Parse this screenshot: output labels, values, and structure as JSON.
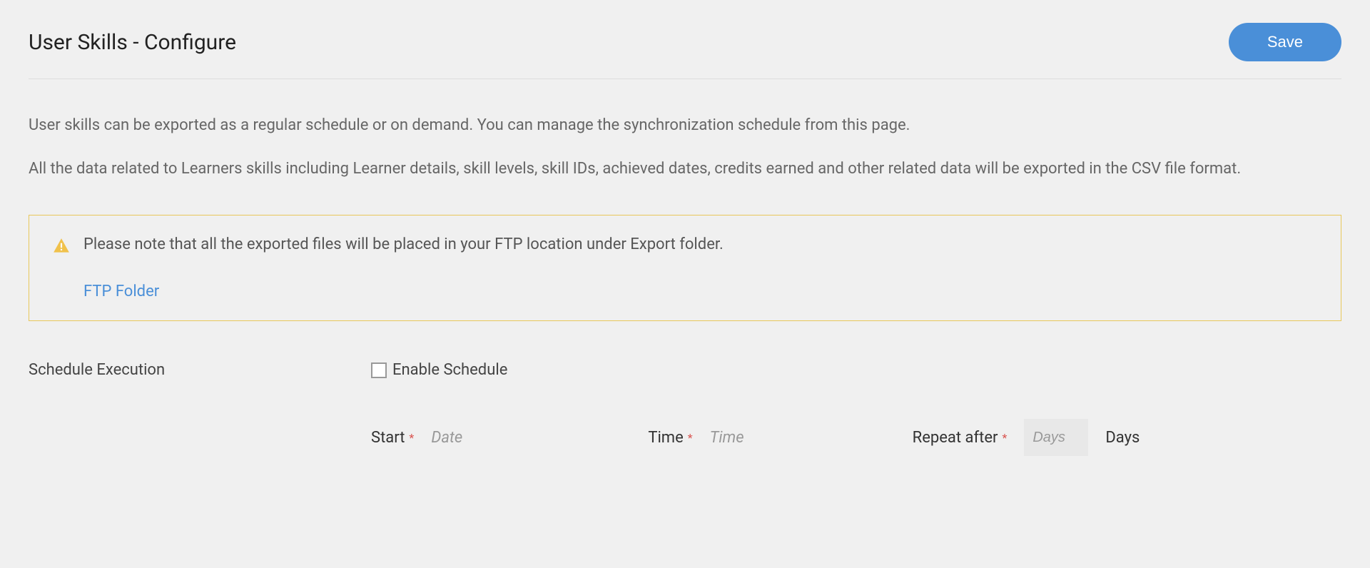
{
  "header": {
    "title": "User Skills - Configure",
    "save_label": "Save"
  },
  "description": {
    "para1": "User skills can be exported as a regular schedule or on demand. You can manage the synchronization schedule from this page.",
    "para2": "All the data related to Learners skills including Learner details, skill levels, skill IDs, achieved dates, credits earned and other related data will be exported in the CSV file format."
  },
  "notice": {
    "text": "Please note that all the exported files will be placed in your FTP location under Export folder.",
    "link_label": "FTP Folder"
  },
  "form": {
    "schedule_label": "Schedule Execution",
    "enable_label": "Enable Schedule",
    "start_label": "Start",
    "date_placeholder": "Date",
    "time_label": "Time",
    "time_placeholder": "Time",
    "repeat_label": "Repeat after",
    "days_placeholder": "Days",
    "days_suffix": "Days",
    "required_mark": "*"
  }
}
